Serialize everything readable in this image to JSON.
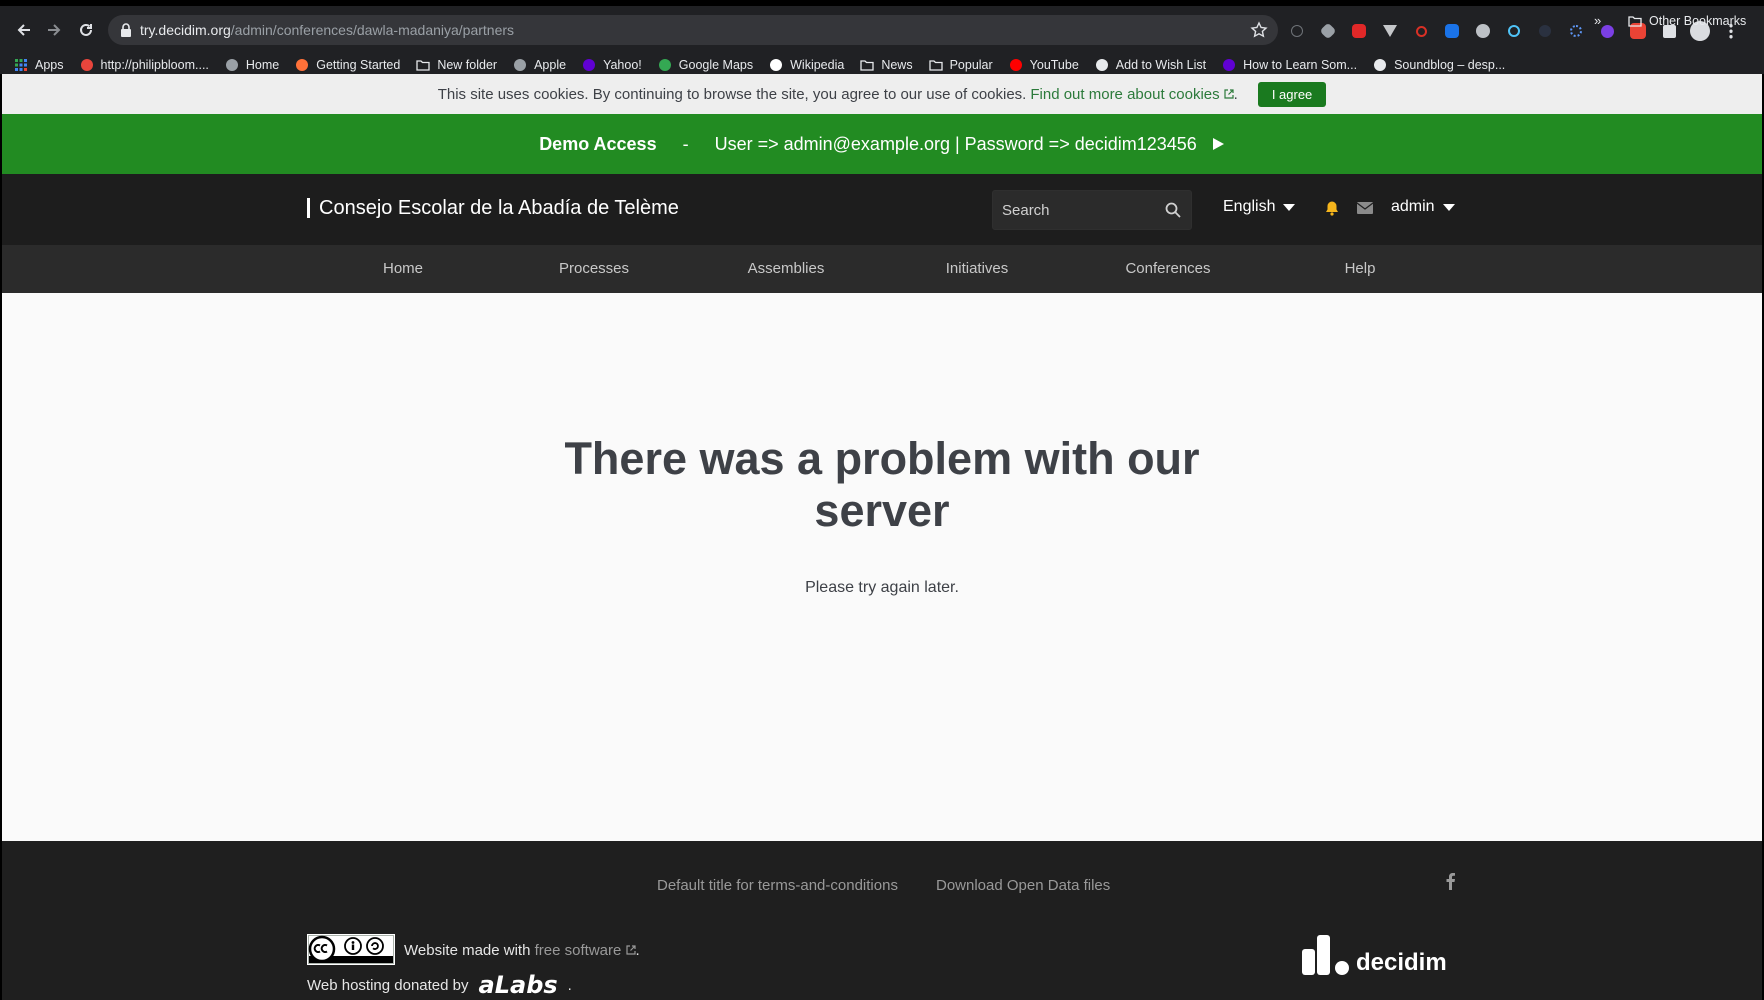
{
  "browser": {
    "url_host": "try.decidim.org",
    "url_path": "/admin/conferences/dawla-madaniya/partners",
    "bookmarks": [
      {
        "label": "Apps",
        "icon": "apps-grid-icon",
        "color": "#e8453c"
      },
      {
        "label": "http://philipbloom....",
        "icon": "pb-icon",
        "color": "#e8453c"
      },
      {
        "label": "Home",
        "icon": "home-icon",
        "color": "#9aa0a6"
      },
      {
        "label": "Getting Started",
        "icon": "firefox-icon",
        "color": "#ff7139"
      },
      {
        "label": "New folder",
        "icon": "folder-icon",
        "color": "#e8eaed"
      },
      {
        "label": "Apple",
        "icon": "apple-icon",
        "color": "#9aa0a6"
      },
      {
        "label": "Yahoo!",
        "icon": "yahoo-icon",
        "color": "#6001d2"
      },
      {
        "label": "Google Maps",
        "icon": "maps-pin-icon",
        "color": "#34a853"
      },
      {
        "label": "Wikipedia",
        "icon": "wikipedia-icon",
        "color": "#ffffff"
      },
      {
        "label": "News",
        "icon": "folder-icon",
        "color": "#e8eaed"
      },
      {
        "label": "Popular",
        "icon": "folder-icon",
        "color": "#e8eaed"
      },
      {
        "label": "YouTube",
        "icon": "youtube-icon",
        "color": "#ff0000"
      },
      {
        "label": "Add to Wish List",
        "icon": "amazon-icon",
        "color": "#e8eaed"
      },
      {
        "label": "How to Learn Som...",
        "icon": "yahoo-icon",
        "color": "#6001d2"
      },
      {
        "label": "Soundblog – desp...",
        "icon": "soundblog-icon",
        "color": "#e8eaed"
      }
    ],
    "more": "»",
    "other_bookmarks": "Other Bookmarks"
  },
  "cookie_bar": {
    "text": "This site uses cookies. By continuing to browse the site, you agree to our use of cookies.",
    "link": "Find out more about cookies",
    "after_link": ".",
    "agree": "I agree"
  },
  "demo": {
    "title": "Demo Access",
    "separator": "-",
    "credentials": "User => admin@example.org | Password => decidim123456"
  },
  "header": {
    "org_name": "Consejo Escolar de la Abadía de Telème",
    "search_placeholder": "Search",
    "language": "English",
    "user": "admin"
  },
  "nav": {
    "items": [
      "Home",
      "Processes",
      "Assemblies",
      "Initiatives",
      "Conferences",
      "Help"
    ]
  },
  "error": {
    "title": "There was a problem with our server",
    "message": "Please try again later."
  },
  "footer": {
    "terms": "Default title for terms-and-conditions",
    "open_data": "Download Open Data files",
    "made_with_prefix": "Website made with",
    "free_software": "free software",
    "made_with_suffix": ".",
    "hosting": "Web hosting donated by",
    "hosting_brand": "aLabs",
    "hosting_suffix": ".",
    "logo_text": "decidim"
  },
  "colors": {
    "demo_green": "#228b22",
    "agree_green": "#1a7a1f",
    "header_dark": "#1d1d1d",
    "bell_yellow": "#f5b51c"
  }
}
